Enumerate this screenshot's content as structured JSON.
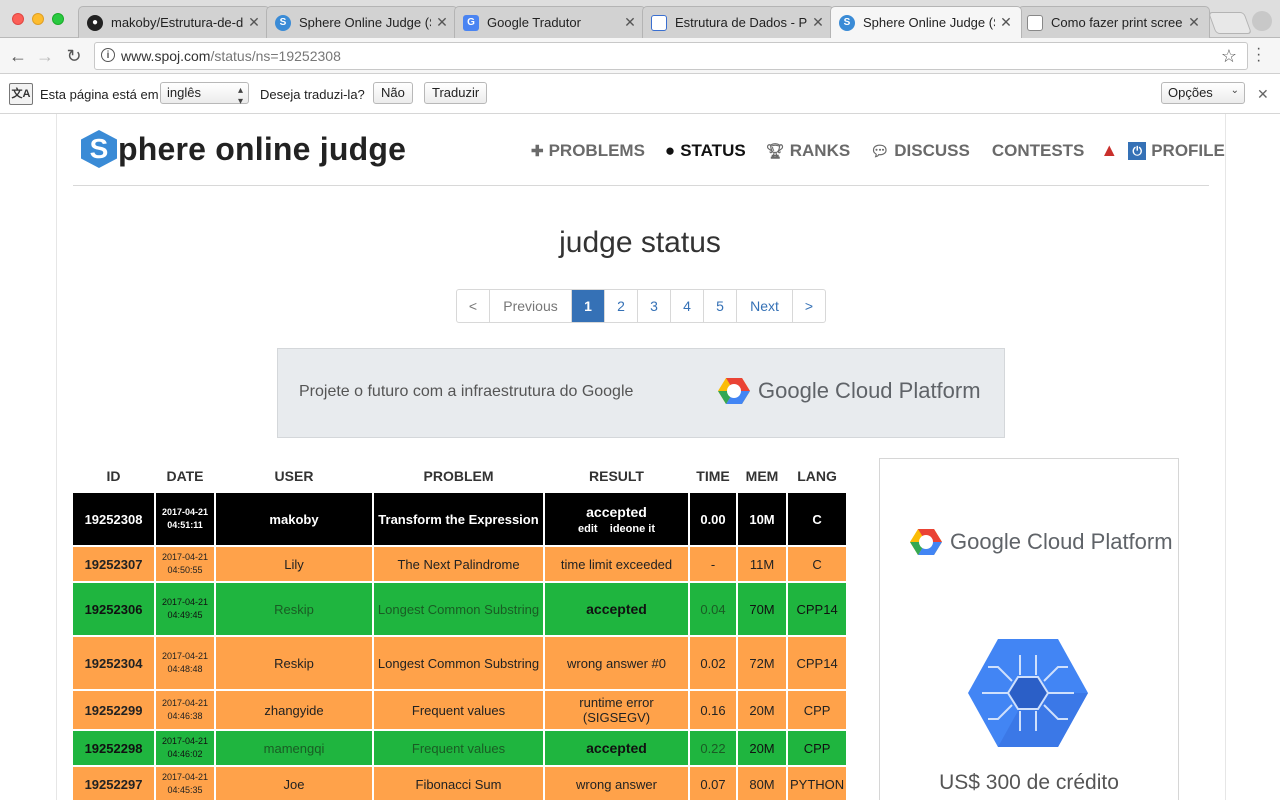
{
  "browser": {
    "tabs": [
      {
        "title": "makoby/Estrutura-de-d",
        "icon": "github-icon",
        "active": false
      },
      {
        "title": "Sphere Online Judge (S",
        "icon": "spoj-icon",
        "active": false
      },
      {
        "title": "Google Tradutor",
        "icon": "google-translate-icon",
        "active": false
      },
      {
        "title": "Estrutura de Dados - Pr",
        "icon": "document-icon",
        "active": false
      },
      {
        "title": "Sphere Online Judge (S",
        "icon": "spoj-icon",
        "active": true
      },
      {
        "title": "Como fazer print screen",
        "icon": "page-icon",
        "active": false
      }
    ],
    "url_host": "www.spoj.com",
    "url_path": "/status/ns=19252308"
  },
  "translate_bar": {
    "prompt": "Esta página está em",
    "language": "inglês",
    "question": "Deseja traduzi-la?",
    "no_label": "Não",
    "translate_label": "Traduzir",
    "options_label": "Opções"
  },
  "site": {
    "logo_letter": "S",
    "logo_text": "phere online judge",
    "nav": {
      "problems": "PROBLEMS",
      "status": "STATUS",
      "ranks": "RANKS",
      "discuss": "DISCUSS",
      "contests": "CONTESTS",
      "profile": "PROFILE"
    }
  },
  "page_title": "judge status",
  "pagination": {
    "prev_arrow": "<",
    "previous": "Previous",
    "pages": [
      "1",
      "2",
      "3",
      "4",
      "5"
    ],
    "active_page": "1",
    "next": "Next",
    "next_arrow": ">"
  },
  "ad_banner": {
    "text": "Projete o futuro com a infraestrutura do Google",
    "brand": "Google Cloud Platform"
  },
  "table": {
    "headers": {
      "id": "ID",
      "date": "DATE",
      "user": "USER",
      "problem": "PROBLEM",
      "result": "RESULT",
      "time": "TIME",
      "mem": "MEM",
      "lang": "LANG"
    },
    "rows": [
      {
        "id": "19252308",
        "date1": "2017-04-21",
        "date2": "04:51:11",
        "user": "makoby",
        "problem": "Transform the Expression",
        "result": "accepted",
        "result_links": "edit    ideone it",
        "time": "0.00",
        "mem": "10M",
        "lang": "C",
        "color": "black"
      },
      {
        "id": "19252307",
        "date1": "2017-04-21",
        "date2": "04:50:55",
        "user": "Lily",
        "problem": "The Next Palindrome",
        "result": "time limit exceeded",
        "time": "-",
        "mem": "11M",
        "lang": "C",
        "color": "orange"
      },
      {
        "id": "19252306",
        "date1": "2017-04-21",
        "date2": "04:49:45",
        "user": "Reskip",
        "problem": "Longest Common Substring",
        "result": "accepted",
        "time": "0.04",
        "mem": "70M",
        "lang": "CPP14",
        "color": "green"
      },
      {
        "id": "19252304",
        "date1": "2017-04-21",
        "date2": "04:48:48",
        "user": "Reskip",
        "problem": "Longest Common Substring",
        "result": "wrong answer #0",
        "time": "0.02",
        "mem": "72M",
        "lang": "CPP14",
        "color": "orange"
      },
      {
        "id": "19252299",
        "date1": "2017-04-21",
        "date2": "04:46:38",
        "user": "zhangyide",
        "problem": "Frequent values",
        "result": "runtime error (SIGSEGV)",
        "time": "0.16",
        "mem": "20M",
        "lang": "CPP",
        "color": "orange"
      },
      {
        "id": "19252298",
        "date1": "2017-04-21",
        "date2": "04:46:02",
        "user": "mamengqi",
        "problem": "Frequent values",
        "result": "accepted",
        "time": "0.22",
        "mem": "20M",
        "lang": "CPP",
        "color": "green"
      },
      {
        "id": "19252297",
        "date1": "2017-04-21",
        "date2": "04:45:35",
        "user": "Joe",
        "problem": "Fibonacci Sum",
        "result": "wrong answer",
        "time": "0.07",
        "mem": "80M",
        "lang": "PYTHON",
        "color": "orange"
      }
    ]
  },
  "side_ad": {
    "brand": "Google Cloud Platform",
    "credit": "US$ 300 de crédito"
  },
  "colors": {
    "accepted_green": "#1fb53f",
    "error_orange": "#ffa24a",
    "link_blue": "#3571b6"
  }
}
